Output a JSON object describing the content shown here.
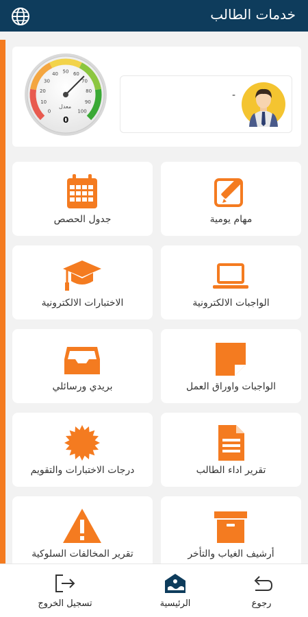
{
  "header": {
    "title": "خدمات الطالب",
    "globe_icon": "globe-icon"
  },
  "profile": {
    "name": "-",
    "avatar_icon": "student-avatar"
  },
  "gauge": {
    "unit_label": "معدل",
    "value_text": "0",
    "value": 0,
    "min": 0,
    "max": 100,
    "ticks": [
      "0",
      "10",
      "20",
      "30",
      "40",
      "50",
      "60",
      "70",
      "80",
      "90",
      "100"
    ],
    "colors": [
      "#e85a4f",
      "#f4a640",
      "#f2d34a",
      "#8cc63f",
      "#3aa935"
    ]
  },
  "tiles": [
    {
      "label": "مهام يومية",
      "icon": "edit-icon"
    },
    {
      "label": "جدول الحصص",
      "icon": "calendar-icon"
    },
    {
      "label": "الواجبات الالكترونية",
      "icon": "laptop-icon"
    },
    {
      "label": "الاختبارات الالكترونية",
      "icon": "graduation-cap-icon"
    },
    {
      "label": "الواجبات واوراق العمل",
      "icon": "sticky-note-icon"
    },
    {
      "label": "بريدي ورسائلي",
      "icon": "inbox-icon"
    },
    {
      "label": "تقرير اداء الطالب",
      "icon": "document-icon"
    },
    {
      "label": "درجات الاختبارات والتقويم",
      "icon": "badge-icon"
    },
    {
      "label": "أرشيف الغياب والتأخر",
      "icon": "archive-box-icon"
    },
    {
      "label": "تقرير المخالفات السلوكية",
      "icon": "warning-icon"
    }
  ],
  "nav": {
    "back": "رجوع",
    "home": "الرئيسية",
    "logout": "تسجيل الخروج"
  },
  "colors": {
    "header": "#0e3c5c",
    "accent": "#f47b20",
    "icon": "#f47b20"
  }
}
